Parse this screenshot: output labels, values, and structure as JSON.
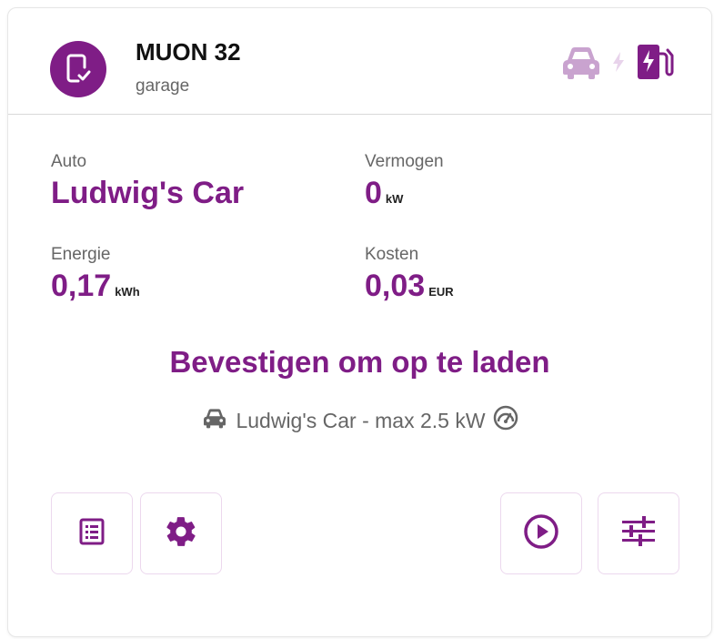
{
  "charger": {
    "name": "MUON 32",
    "location": "garage",
    "icons": {
      "avatar": "charger-phone-check-icon",
      "car": "car-icon",
      "bolt": "bolt-icon",
      "station": "charging-station-icon"
    }
  },
  "stats": {
    "auto_label": "Auto",
    "auto_value": "Ludwig's Car",
    "power_label": "Vermogen",
    "power_value": "0",
    "power_unit": "kW",
    "energy_label": "Energie",
    "energy_value": "0,17",
    "energy_unit": "kWh",
    "cost_label": "Kosten",
    "cost_value": "0,03",
    "cost_unit": "EUR"
  },
  "confirm_text": "Bevestigen om op te laden",
  "car_info": "Ludwig's Car - max 2.5 kW",
  "buttons": {
    "list": "list-icon",
    "settings": "gear-icon",
    "start": "play-circle-icon",
    "sliders": "sliders-icon"
  },
  "colors": {
    "accent": "#7f1d86",
    "accent_light": "#c9a3cf",
    "muted": "#666666"
  }
}
